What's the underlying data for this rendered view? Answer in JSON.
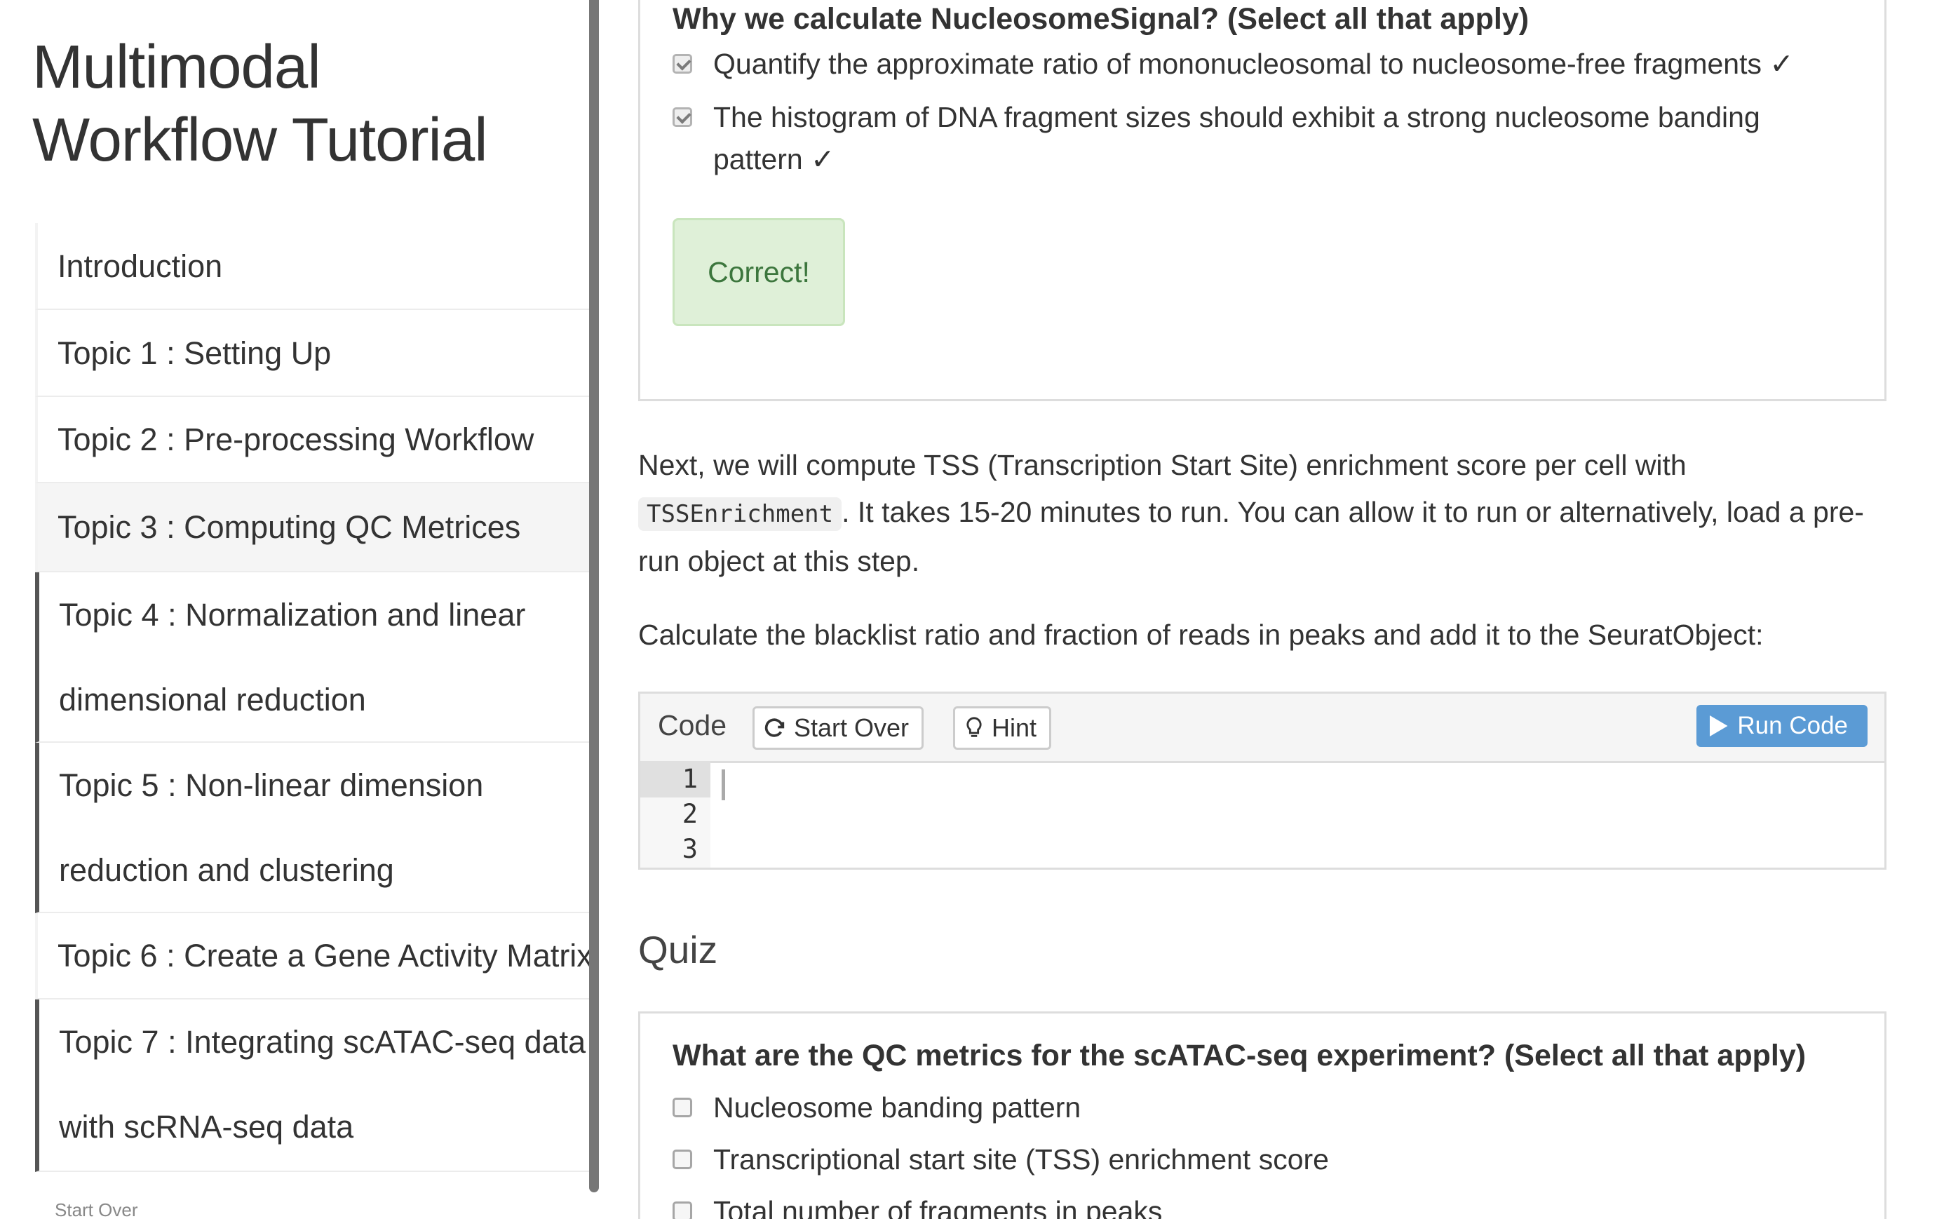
{
  "sidebar": {
    "title": "Multimodal Workflow Tutorial",
    "items": [
      {
        "label": "Introduction"
      },
      {
        "label": "Topic 1 : Setting Up"
      },
      {
        "label": "Topic 2 : Pre-processing Workflow"
      },
      {
        "label": "Topic 3 : Computing QC Metrices"
      },
      {
        "label": "Topic 4 : Normalization and linear dimensional reduction"
      },
      {
        "label": "Topic 5 : Non-linear dimension reduction and clustering"
      },
      {
        "label": "Topic 6 : Create a Gene Activity Matrix"
      },
      {
        "label": "Topic 7 : Integrating scATAC-seq data with scRNA-seq data"
      }
    ],
    "start_over": "Start Over"
  },
  "quiz1": {
    "question": "Why we calculate NucleosomeSignal? (Select all that apply)",
    "options": [
      {
        "label": "Quantify the approximate ratio of mononucleosomal to nucleosome-free fragments ✓",
        "checked": true
      },
      {
        "label": "The histogram of DNA fragment sizes should exhibit a strong nucleosome banding pattern ✓",
        "checked": true
      }
    ],
    "feedback": "Correct!"
  },
  "paragraph1": {
    "before": "Next, we will compute TSS (Transcription Start Site) enrichment score per cell with ",
    "code": "TSSEnrichment",
    "after": ". It takes 15-20 minutes to run. You can allow it to run or alternatively, load a pre-run object at this step."
  },
  "paragraph2": "Calculate the blacklist ratio and fraction of reads in peaks and add it to the SeuratObject:",
  "exercise": {
    "label": "Code",
    "start_over": "Start Over",
    "hint": "Hint",
    "run": "Run Code",
    "line_numbers": [
      "1",
      "2",
      "3"
    ]
  },
  "quiz_heading": "Quiz",
  "quiz2": {
    "question": "What are the QC metrics for the scATAC-seq experiment? (Select all that apply)",
    "options": [
      {
        "label": "Nucleosome banding pattern",
        "checked": false
      },
      {
        "label": "Transcriptional start site (TSS) enrichment score",
        "checked": false
      },
      {
        "label": "Total number of fragments in peaks",
        "checked": false
      }
    ]
  },
  "colors": {
    "success_bg": "#dff0d8",
    "success_text": "#3c763d",
    "run_button": "#5b9bd5"
  }
}
